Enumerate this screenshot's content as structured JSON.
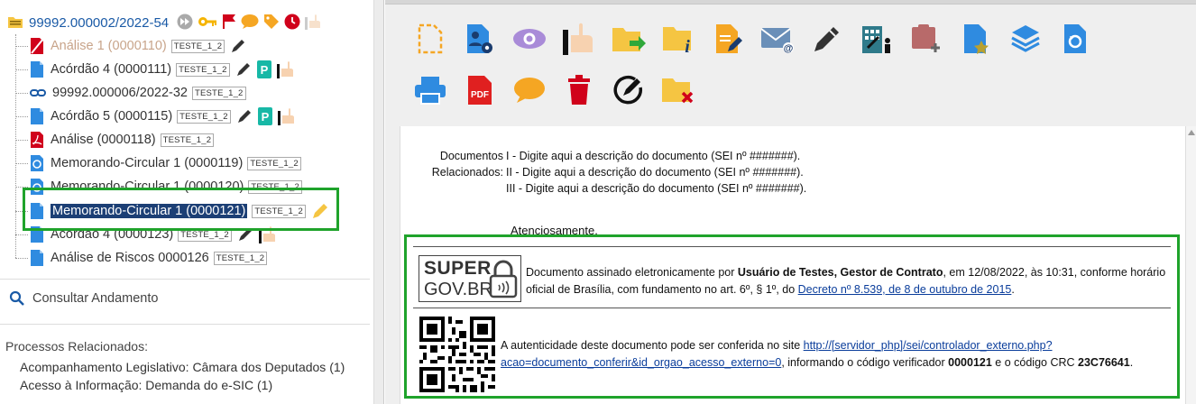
{
  "tree": {
    "root": {
      "label": "99992.000002/2022-54"
    },
    "nodes": [
      {
        "label": "Análise 1 (0000110)",
        "tag": "TESTE_1_2"
      },
      {
        "label": "Acórdão 4 (0000111)",
        "tag": "TESTE_1_2"
      },
      {
        "label": "99992.000006/2022-32",
        "tag": "TESTE_1_2"
      },
      {
        "label": "Acórdão 5 (0000115)",
        "tag": "TESTE_1_2"
      },
      {
        "label": "Análise (0000118)",
        "tag": "TESTE_1_2"
      },
      {
        "label": "Memorando-Circular 1 (0000119)",
        "tag": "TESTE_1_2"
      },
      {
        "label": "Memorando-Circular 1 (0000120)",
        "tag": "TESTE_1_2"
      },
      {
        "label": "Memorando-Circular 1 (0000121)",
        "tag": "TESTE_1_2"
      },
      {
        "label": "Acórdão 4 (0000123)",
        "tag": "TESTE_1_2"
      },
      {
        "label": "Análise de Riscos 0000126",
        "tag": "TESTE_1_2"
      }
    ]
  },
  "left_panel": {
    "consultar": "Consultar Andamento",
    "processos_title": "Processos Relacionados:",
    "processos": [
      "Acompanhamento Legislativo: Câmara dos Deputados (1)",
      "Acesso à Informação: Demanda do e-SIC (1)"
    ]
  },
  "document": {
    "rel_label_1": "Documentos",
    "rel_label_2": "Relacionados:",
    "rel_items": [
      "I - Digite aqui a descrição do documento (SEI nº #######).",
      "II - Digite aqui a descrição do documento (SEI nº #######).",
      "III - Digite aqui a descrição do documento (SEI nº #######)."
    ],
    "atenciosamente": "Atenciosamente,",
    "logo_line1": "SUPER",
    "logo_line2": "GOV.BR",
    "sig_pre": "Documento assinado eletronicamente por ",
    "sig_name": "Usuário de Testes, Gestor de Contrato",
    "sig_mid": ", em 12/08/2022, às 10:31, conforme horário oficial de Brasília, com fundamento no art. 6º, § 1º, do ",
    "sig_link": "Decreto nº 8.539, de 8 de outubro de 2015",
    "sig_end": ".",
    "auth_pre": "A autenticidade deste documento pode ser conferida no site ",
    "auth_link": "http://[servidor_php]/sei/controlador_externo.php?acao=documento_conferir&id_orgao_acesso_externo=0",
    "auth_mid": ", informando o código verificador ",
    "auth_code": "0000121",
    "auth_mid2": " e o código CRC ",
    "auth_crc": "23C76641",
    "auth_end": "."
  },
  "colors": {
    "highlight_border": "#1fa32b",
    "selected_bg": "#1c3f75",
    "link": "#1a5aa6",
    "icon_blue": "#2f8be0",
    "icon_orange": "#f5a623",
    "icon_red": "#d0021b"
  }
}
